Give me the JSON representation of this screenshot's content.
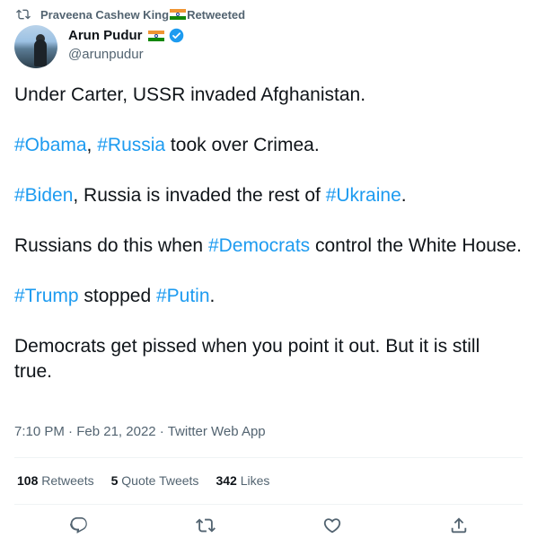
{
  "retweeter": {
    "name": "Praveena Cashew King",
    "suffix": "Retweeted"
  },
  "author": {
    "name": "Arun Pudur",
    "handle": "@arunpudur"
  },
  "tweet": {
    "p1": "Under Carter, USSR invaded Afghanistan.",
    "p2": {
      "tag1": "#Obama",
      "sep": ", ",
      "tag2": "#Russia",
      "rest": " took over Crimea."
    },
    "p3": {
      "tag1": "#Biden",
      "mid": ", Russia is invaded the rest of ",
      "tag2": "#Ukraine",
      "end": "."
    },
    "p4": {
      "pre": "Russians do this when ",
      "tag": "#Democrats",
      "post": " control the White House."
    },
    "p5": {
      "tag1": "#Trump",
      "mid": " stopped ",
      "tag2": "#Putin",
      "end": "."
    },
    "p6": "Democrats get pissed when you point it out.  But it is still true."
  },
  "meta": {
    "time": "7:10 PM",
    "date": "Feb 21, 2022",
    "source": "Twitter Web App",
    "dot": " · "
  },
  "stats": {
    "retweets": {
      "count": "108",
      "label": "Retweets"
    },
    "quotes": {
      "count": "5",
      "label": "Quote Tweets"
    },
    "likes": {
      "count": "342",
      "label": "Likes"
    }
  },
  "colors": {
    "accent": "#1d9bf0",
    "secondary": "#536471",
    "text": "#0f1419"
  },
  "icons": [
    "retweet-icon",
    "india-flag-icon",
    "verified-badge-icon",
    "reply-icon",
    "like-icon",
    "share-icon"
  ]
}
